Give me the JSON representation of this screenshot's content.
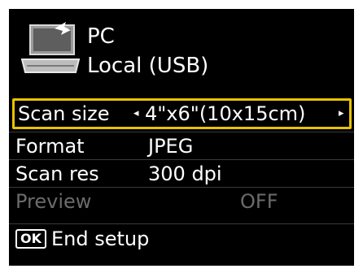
{
  "header": {
    "icon": "pc-icon",
    "device": "PC",
    "connection": "Local (USB)"
  },
  "settings": [
    {
      "label": "Scan size",
      "value": "4\"x6\"(10x15cm)",
      "selected": true
    },
    {
      "label": "Format",
      "value": "JPEG"
    },
    {
      "label": "Scan res",
      "value": "300 dpi"
    },
    {
      "label": "Preview",
      "value": "OFF",
      "disabled": true
    }
  ],
  "arrows": {
    "left": "◂",
    "right": "▸"
  },
  "footer": {
    "ok_label": "OK",
    "text": "End setup"
  },
  "colors": {
    "screen_bg": "#000000",
    "highlight": "#e8c300",
    "disabled": "#6b6b6b"
  }
}
